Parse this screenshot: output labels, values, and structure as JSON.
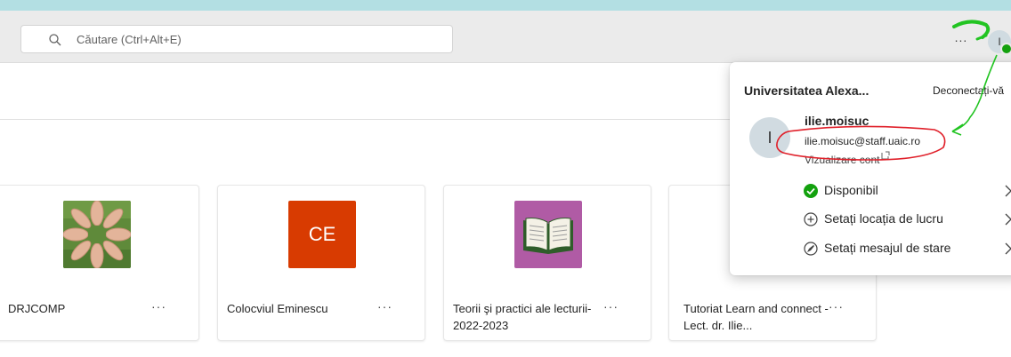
{
  "search": {
    "placeholder": "Căutare (Ctrl+Alt+E)",
    "value": ""
  },
  "header": {
    "more_label": "...",
    "avatar_initial": "I"
  },
  "cards": [
    {
      "title": "DRJCOMP",
      "more": "···",
      "image": "hands-circle-photo"
    },
    {
      "title": "Colocviul Eminescu",
      "more": "···",
      "initials": "CE",
      "tile_color": "#d83b01"
    },
    {
      "title": "Teorii şi practici ale lecturii-2022-2023",
      "more": "···",
      "image": "open-book-icon",
      "tile_color": "#b05ba5"
    },
    {
      "title": "Tutoriat Learn and connect - Lect. dr. Ilie...",
      "more": "···"
    }
  ],
  "account_panel": {
    "organization": "Universitatea Alexa...",
    "sign_out": "Deconectați-vă",
    "avatar_initial": "I",
    "user_name": "ilie.moisuc",
    "email": "ilie.moisuc@staff.uaic.ro",
    "view_account": "Vizualizare cont",
    "menu": [
      {
        "label": "Disponibil",
        "icon": "status-available-icon",
        "color": "#13a10e"
      },
      {
        "label": "Setați locația de lucru",
        "icon": "location-plus-icon"
      },
      {
        "label": "Setați mesajul de stare",
        "icon": "status-message-icon"
      }
    ]
  },
  "annotation_colors": {
    "green": "#22c422",
    "red": "#e0202a"
  }
}
